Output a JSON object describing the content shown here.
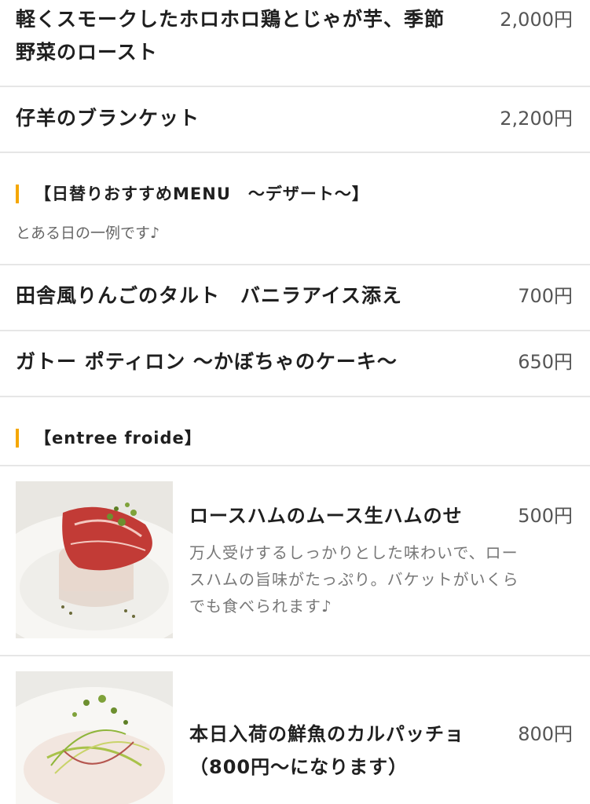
{
  "top_items": [
    {
      "name_line1": "軽くスモークしたホロホロ鶏とじゃが芋、季節",
      "name_line2": "野菜のロースト",
      "price": "2,000円"
    },
    {
      "name": "仔羊のブランケット",
      "price": "2,200円"
    }
  ],
  "dessert_section": {
    "title": "【日替りおすすめMENU　〜デザート〜】",
    "note": "とある日の一例です♪",
    "items": [
      {
        "name": "田舎風りんごのタルト　バニラアイス添え",
        "price": "700円"
      },
      {
        "name": "ガトー ポティロン 〜かぼちゃのケーキ〜",
        "price": "650円"
      }
    ]
  },
  "entree_section": {
    "title": "【entree froide】",
    "items": [
      {
        "name": "ロースハムのムース生ハムのせ",
        "price": "500円",
        "desc_line1": "万人受けするしっかりとした味わいで、ロー",
        "desc_line2": "スハムの旨味がたっぷり。バケットがいくら",
        "desc_line3": "でも食べられます♪",
        "image": "ham-mousse-photo"
      },
      {
        "name_line1": "本日入荷の鮮魚のカルパッチョ",
        "name_line2": "（800円〜になります）",
        "price": "800円",
        "image": "carpaccio-photo"
      }
    ]
  },
  "colors": {
    "accent": "#f5a700",
    "divider": "#e6e6e6"
  }
}
